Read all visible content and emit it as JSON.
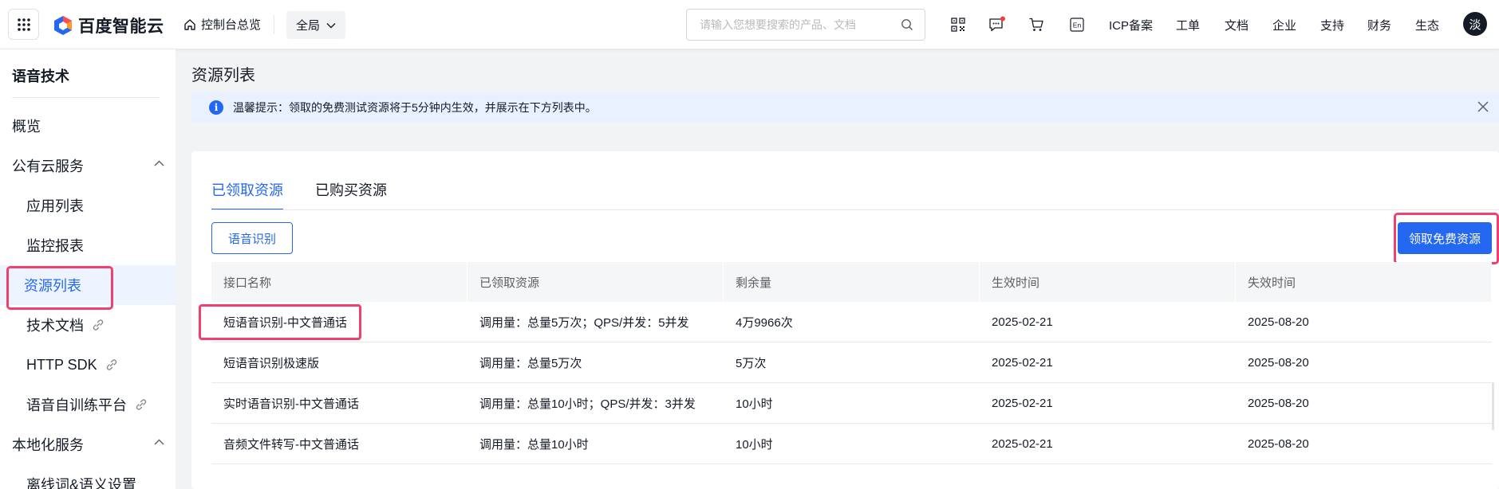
{
  "header": {
    "logo_text": "百度智能云",
    "overview_label": "控制台总览",
    "scope_label": "全局",
    "search_placeholder": "请输入您想要搜索的产品、文档",
    "icp_label": "ICP备案",
    "ticket_label": "工单",
    "docs_label": "文档",
    "enterprise_label": "企业",
    "support_label": "支持",
    "finance_label": "财务",
    "ecosystem_label": "生态",
    "avatar_text": "淡",
    "lang_icon_text": "En"
  },
  "sidebar": {
    "title": "语音技术",
    "items": [
      {
        "label": "概览"
      },
      {
        "label": "公有云服务"
      },
      {
        "label": "应用列表"
      },
      {
        "label": "监控报表"
      },
      {
        "label": "资源列表"
      },
      {
        "label": "技术文档"
      },
      {
        "label": "HTTP SDK"
      },
      {
        "label": "语音自训练平台"
      },
      {
        "label": "本地化服务"
      },
      {
        "label": "离线词&语义设置"
      }
    ]
  },
  "main": {
    "page_title": "资源列表",
    "notice": "温馨提示：领取的免费测试资源将于5分钟内生效，并展示在下方列表中。",
    "tabs": [
      {
        "label": "已领取资源"
      },
      {
        "label": "已购买资源"
      }
    ],
    "filter_button": "语音识别",
    "claim_button": "领取免费资源",
    "table": {
      "headers": [
        "接口名称",
        "已领取资源",
        "剩余量",
        "生效时间",
        "失效时间"
      ],
      "rows": [
        [
          "短语音识别-中文普通话",
          "调用量：总量5万次；QPS/并发：5并发",
          "4万9966次",
          "2025-02-21",
          "2025-08-20"
        ],
        [
          "短语音识别极速版",
          "调用量：总量5万次",
          "5万次",
          "2025-02-21",
          "2025-08-20"
        ],
        [
          "实时语音识别-中文普通话",
          "调用量：总量10小时；QPS/并发：3并发",
          "10小时",
          "2025-02-21",
          "2025-08-20"
        ],
        [
          "音频文件转写-中文普通话",
          "调用量：总量10小时",
          "10小时",
          "2025-02-21",
          "2025-08-20"
        ]
      ]
    }
  },
  "colors": {
    "primary": "#2468f2",
    "highlight": "#f0416e",
    "notice_bg": "#e9f0ff"
  }
}
